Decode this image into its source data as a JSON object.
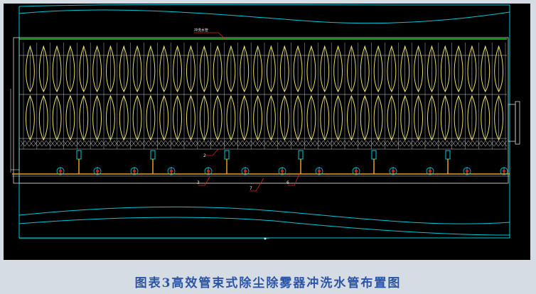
{
  "drawing": {
    "top_tag": "冲洗水管",
    "callouts": [
      "2",
      "3",
      "7",
      "6"
    ],
    "colors": {
      "background": "#000000",
      "frame": "#00c8d8",
      "line": "#d8d8d8",
      "header_pipe": "#18d018",
      "tubes": "#e8e060",
      "water_pipe": "#e8a020",
      "nozzle": "#d02020",
      "leader": "#e02020"
    }
  },
  "caption": "图表3高效管束式除尘除雾器冲洗水管布置图"
}
